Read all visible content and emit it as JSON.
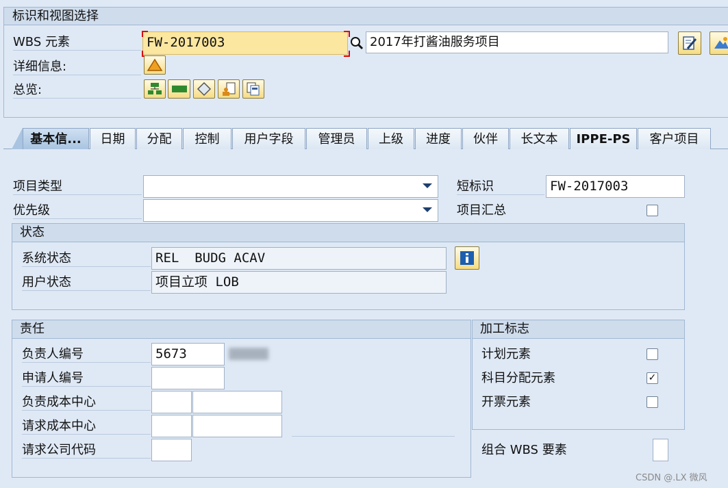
{
  "header": {
    "title": "标识和视图选择",
    "wbs_label": "WBS 元素",
    "wbs_value": "FW-2017003",
    "wbs_desc": "2017年打酱油服务项目",
    "detail_label": "详细信息:",
    "overview_label": "总览:"
  },
  "tabs": [
    "基本信...",
    "日期",
    "分配",
    "控制",
    "用户字段",
    "管理员",
    "上级",
    "进度",
    "伙伴",
    "长文本",
    "IPPE-PS",
    "客户项目"
  ],
  "basic": {
    "project_type_label": "项目类型",
    "project_type_value": "",
    "priority_label": "优先级",
    "priority_value": "",
    "short_id_label": "短标识",
    "short_id_value": "FW-2017003",
    "summary_label": "项目汇总"
  },
  "status": {
    "title": "状态",
    "system_label": "系统状态",
    "system_value": "REL  BUDG ACAV",
    "user_label": "用户状态",
    "user_value": "项目立项 LOB"
  },
  "responsibility": {
    "title": "责任",
    "resp_person_label": "负责人编号",
    "resp_person_value": "5673",
    "applicant_label": "申请人编号",
    "resp_cc_label": "负责成本中心",
    "req_cc_label": "请求成本中心",
    "req_company_label": "请求公司代码"
  },
  "process": {
    "title": "加工标志",
    "plan_label": "计划元素",
    "account_label": "科目分配元素",
    "billing_label": "开票元素",
    "account_checked": "✓"
  },
  "group_wbs_label": "组合 WBS 要素",
  "watermark": "CSDN @.LX 微风"
}
